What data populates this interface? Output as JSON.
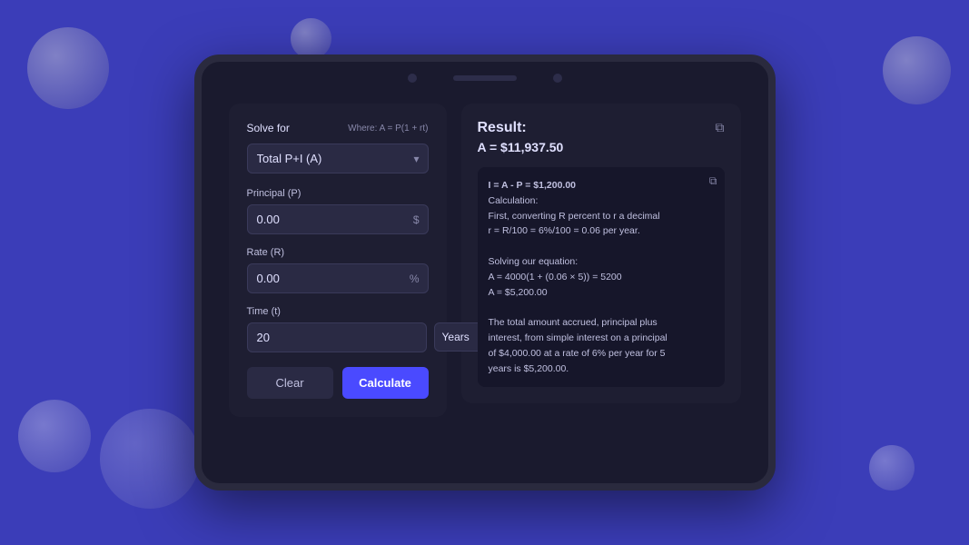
{
  "background": {
    "color": "#3b3db8"
  },
  "calculator": {
    "solve_for_label": "Solve for",
    "formula_text": "Where: A = P(1 + rt)",
    "solve_for_value": "Total P+I (A)",
    "principal_label": "Principal (P)",
    "principal_value": "0.00",
    "principal_suffix": "$",
    "rate_label": "Rate (R)",
    "rate_value": "0.00",
    "rate_suffix": "%",
    "time_label": "Time (t)",
    "time_value": "20",
    "time_unit": "Years",
    "clear_label": "Clear",
    "calculate_label": "Calculate"
  },
  "result": {
    "title": "Result:",
    "value": "A = $11,937.50",
    "detail_line1": "I = A - P = $1,200.00",
    "detail_line2": "Calculation:",
    "detail_line3": "First, converting R percent to r a decimal",
    "detail_line4": "r = R/100 = 6%/100 = 0.06 per year.",
    "detail_line5": "",
    "detail_line6": "Solving our equation:",
    "detail_line7": "A = 4000(1 + (0.06 × 5)) = 5200",
    "detail_line8": "A = $5,200.00",
    "detail_line9": "",
    "detail_line10": "The total amount accrued, principal plus",
    "detail_line11": "interest, from simple interest on a principal",
    "detail_line12": "of $4,000.00 at a rate of 6% per year for 5",
    "detail_line13": "years is $5,200.00."
  }
}
